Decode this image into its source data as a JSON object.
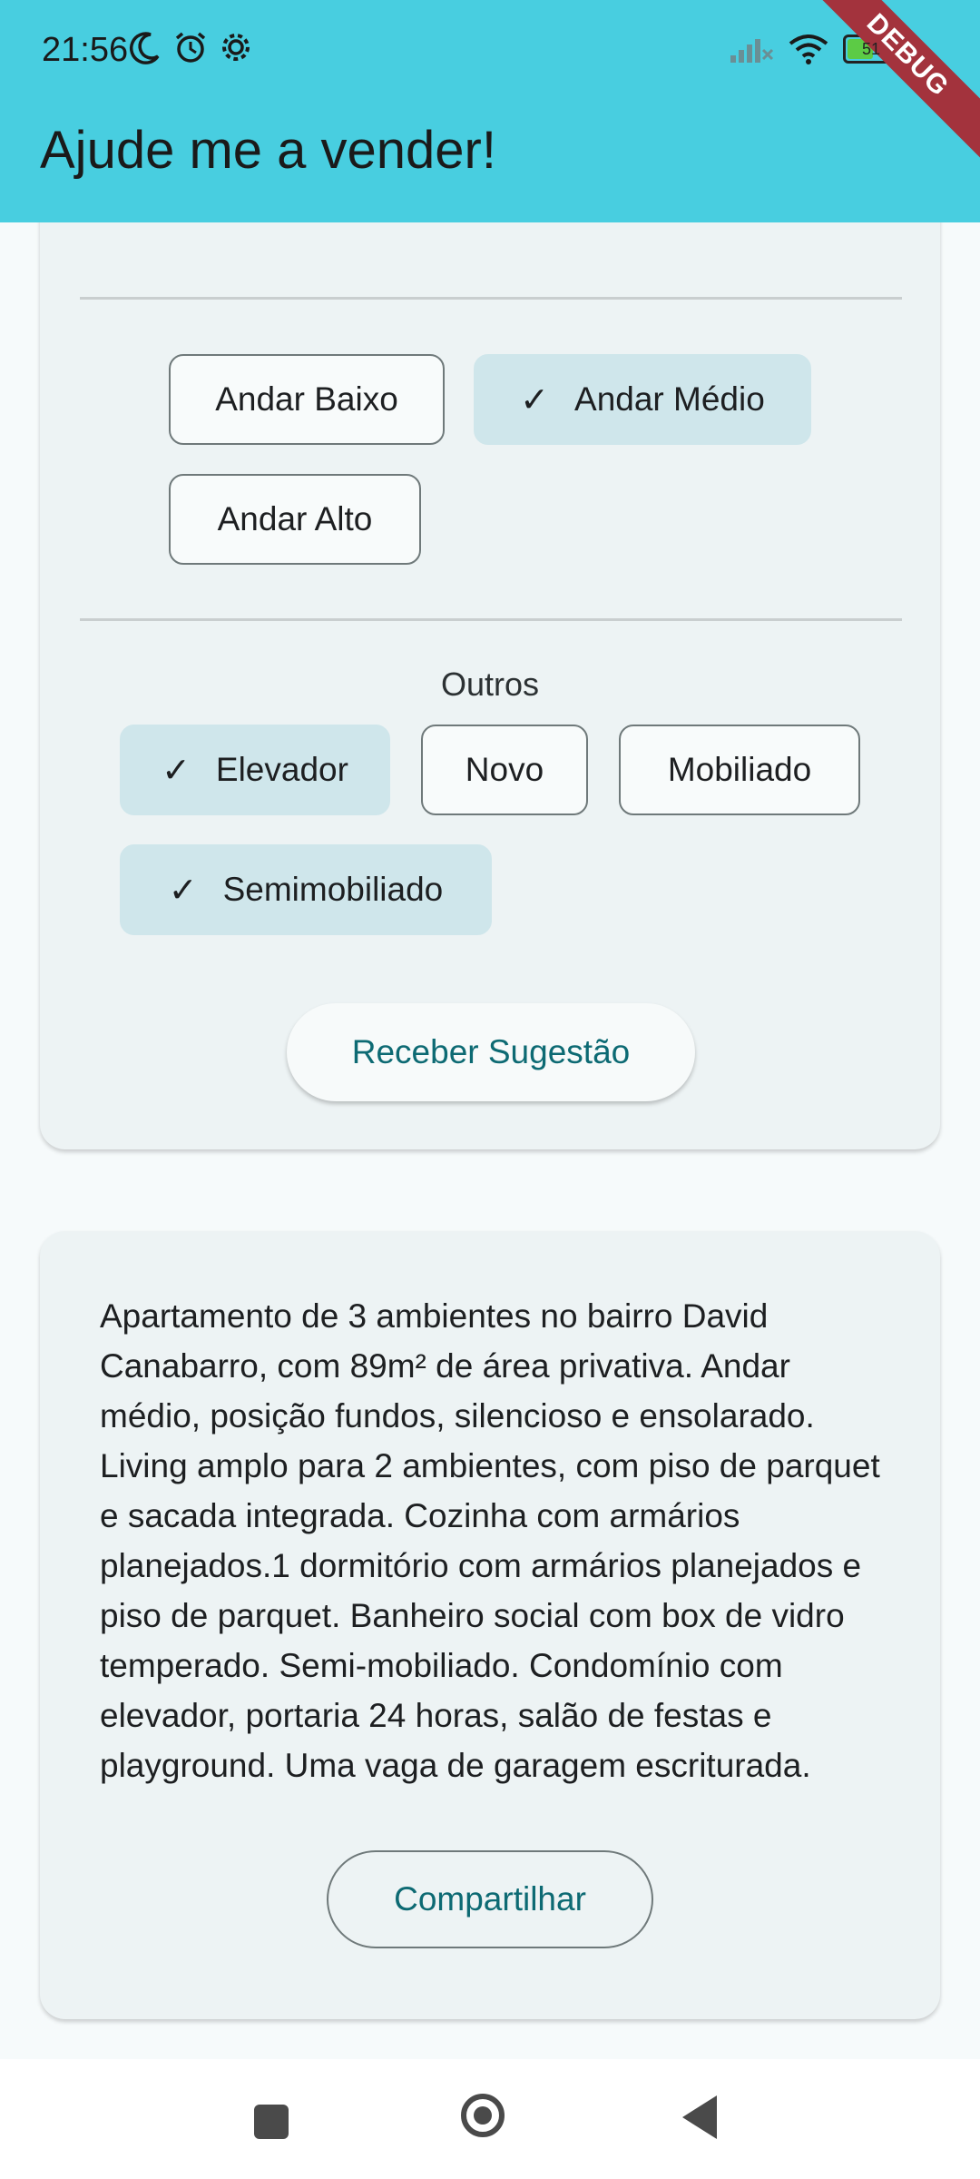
{
  "status_bar": {
    "time": "21:56",
    "left_icons": [
      "moon-icon",
      "alarm-icon",
      "gear-icon"
    ],
    "right_icons": [
      "signal-icon",
      "wifi-icon",
      "battery-icon"
    ],
    "battery_level": "51"
  },
  "app_bar": {
    "title": "Ajude me a vender!",
    "debug_banner": "DEBUG",
    "color": "#48cee0"
  },
  "filters": {
    "floor_chips": [
      {
        "label": "Andar Baixo",
        "selected": false
      },
      {
        "label": "Andar Médio",
        "selected": true
      },
      {
        "label": "Andar Alto",
        "selected": false
      }
    ],
    "others_label": "Outros",
    "other_chips": [
      {
        "label": "Elevador",
        "selected": true
      },
      {
        "label": "Novo",
        "selected": false
      },
      {
        "label": "Mobiliado",
        "selected": false
      },
      {
        "label": "Semimobiliado",
        "selected": true
      }
    ],
    "suggest_button": "Receber Sugestão"
  },
  "result": {
    "description": "Apartamento de 3 ambientes no bairro David Canabarro, com 89m² de área privativa. Andar médio, posição fundos, silencioso e ensolarado. Living amplo para 2 ambientes, com piso de parquet e sacada integrada. Cozinha com armários planejados.1 dormitório com armários planejados e piso de parquet. Banheiro social com box de vidro temperado. Semi-mobiliado. Condomínio com elevador, portaria 24 horas, salão de festas e playground. Uma vaga de garagem escriturada.",
    "share_button": "Compartilhar"
  },
  "nav_bar": {
    "buttons": [
      "recents-icon",
      "home-icon",
      "back-icon"
    ]
  },
  "colors": {
    "accent": "#0d6a73",
    "chip_selected": "#cfe6eb",
    "card_background": "#edf3f4"
  }
}
